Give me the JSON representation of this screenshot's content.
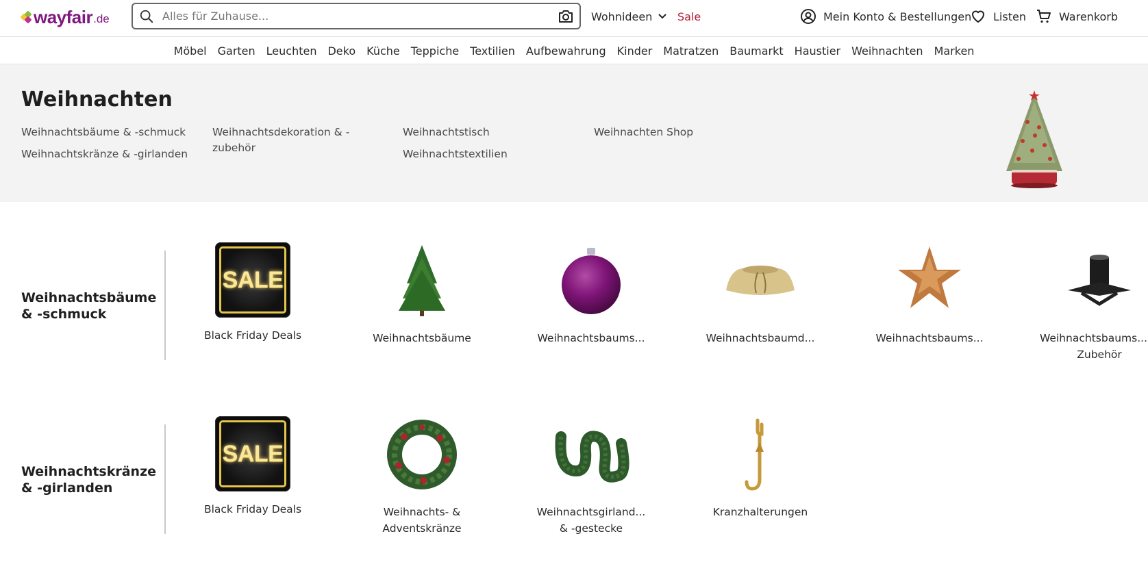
{
  "header": {
    "logo_text": "wayfair",
    "logo_tld": ".de",
    "search_placeholder": "Alles für Zuhause...",
    "wohnideen": "Wohnideen",
    "sale": "Sale",
    "account": "Mein Konto & Bestellungen",
    "lists": "Listen",
    "cart": "Warenkorb"
  },
  "nav": [
    "Möbel",
    "Garten",
    "Leuchten",
    "Deko",
    "Küche",
    "Teppiche",
    "Textilien",
    "Aufbewahrung",
    "Kinder",
    "Matratzen",
    "Baumarkt",
    "Haustier",
    "Weihnachten",
    "Marken"
  ],
  "hero": {
    "title": "Weihnachten",
    "col1": [
      "Weihnachtsbäume & -schmuck",
      "Weihnachtskränze & -girlanden"
    ],
    "col2": [
      "Weihnachtsdekoration & -zubehör"
    ],
    "col3": [
      "Weihnachtstisch",
      "Weihnachtstextilien"
    ],
    "col4": [
      "Weihnachten Shop"
    ]
  },
  "sections": [
    {
      "title": "Weihnachtsbäume & -schmuck",
      "tiles": [
        {
          "label": "Black Friday Deals",
          "icon": "sale-badge",
          "sale_text": "SALE"
        },
        {
          "label": "Weihnachtsbäume",
          "icon": "christmas-tree-icon"
        },
        {
          "label": "Weihnachtsbaums...",
          "icon": "ornament-ball-icon"
        },
        {
          "label": "Weihnachtsbaumd...",
          "icon": "tree-skirt-icon"
        },
        {
          "label": "Weihnachtsbaums...",
          "icon": "star-topper-icon"
        },
        {
          "label": "Weihnachtsbaums... & Zubehör",
          "icon": "tree-stand-icon"
        }
      ]
    },
    {
      "title": "Weihnachtskränze & -girlanden",
      "tiles": [
        {
          "label": "Black Friday Deals",
          "icon": "sale-badge",
          "sale_text": "SALE"
        },
        {
          "label": "Weihnachts- & Adventskränze",
          "icon": "wreath-icon"
        },
        {
          "label": "Weihnachtsgirland... & -gestecke",
          "icon": "garland-icon"
        },
        {
          "label": "Kranzhalterungen",
          "icon": "wreath-hanger-icon"
        }
      ]
    }
  ],
  "colors": {
    "brand": "#7f187f",
    "sale": "#b31e3a",
    "hero_bg": "#f3f3f3"
  }
}
